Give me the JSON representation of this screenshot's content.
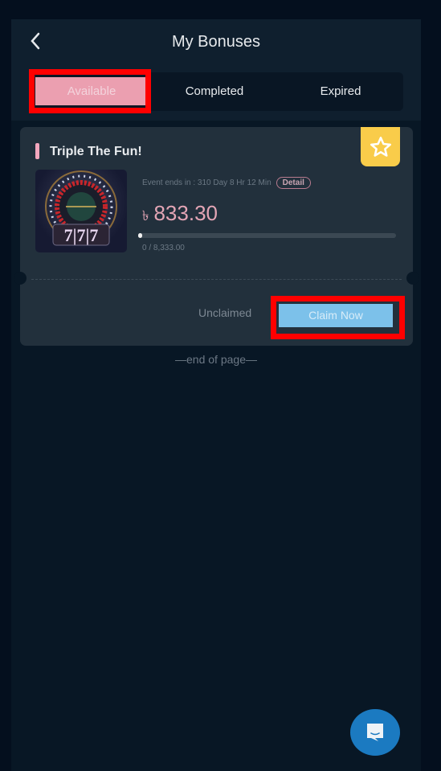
{
  "header": {
    "title": "My Bonuses",
    "back_icon": "chevron-left-icon"
  },
  "tabs": [
    {
      "label": "Available",
      "active": true
    },
    {
      "label": "Completed",
      "active": false
    },
    {
      "label": "Expired",
      "active": false
    }
  ],
  "bonus": {
    "title": "Triple The Fun!",
    "badge_icon": "star-icon",
    "countdown_label": "Event ends in : 310 Day 8 Hr 12 Min",
    "detail_label": "Detail",
    "currency_symbol": "৳",
    "amount": "833.30",
    "progress_current": 0,
    "progress_target": 8333,
    "progress_text": "0 / 8,333.00",
    "status": "Unclaimed",
    "claim_label": "Claim Now"
  },
  "footer": {
    "end_text": "—end of page—"
  },
  "chat": {
    "icon": "chat-icon"
  },
  "colors": {
    "accent_pink": "#eb9fb0",
    "claim_blue": "#7cc1ea",
    "badge_yellow": "#f9cc4a",
    "chat_blue": "#1b7ac1"
  }
}
